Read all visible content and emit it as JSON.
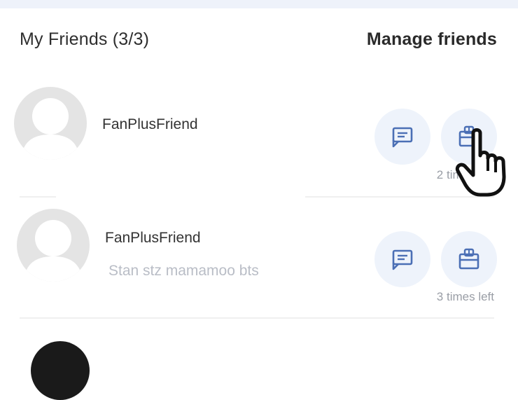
{
  "header": {
    "title": "My Friends (3/3)",
    "manage_label": "Manage friends"
  },
  "friends": [
    {
      "name": "FanPlusFriend",
      "status": "",
      "times_left": "2 times left",
      "avatar": "default-avatar"
    },
    {
      "name": "FanPlusFriend",
      "status": "Stan stz mamamoo bts",
      "times_left": "3 times left",
      "avatar": "default-avatar"
    }
  ],
  "icons": {
    "message": "message-icon",
    "gift": "gift-icon",
    "cursor": "pointer-hand-icon"
  },
  "colors": {
    "accent": "#4b6fb5",
    "button_bg": "#eef3fb",
    "avatar_bg": "#e4e4e4",
    "muted_text": "#b9bdc6"
  }
}
